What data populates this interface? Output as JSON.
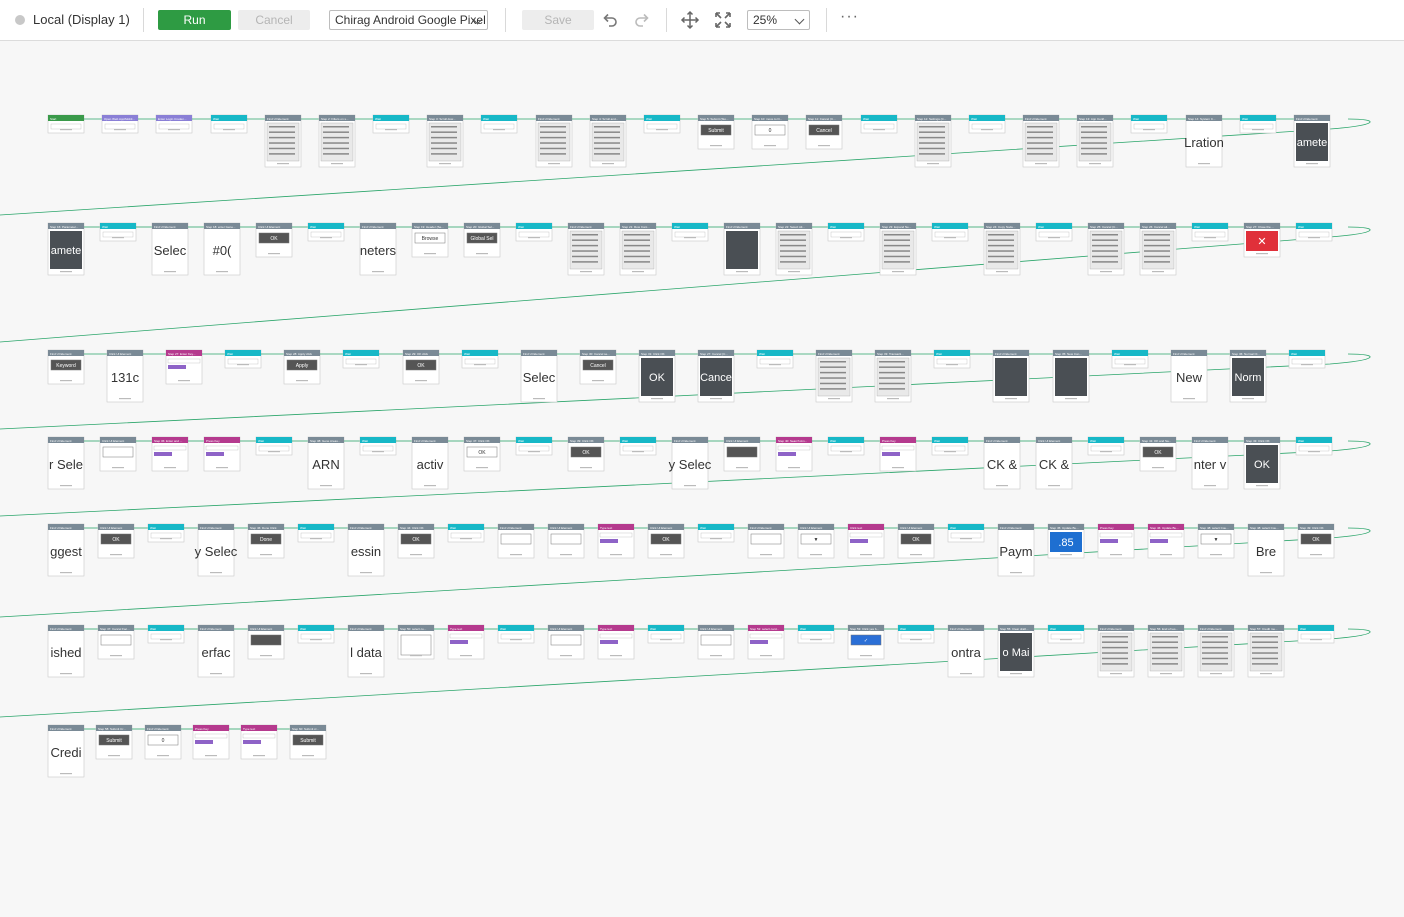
{
  "toolbar": {
    "run_target": "Local (Display 1)",
    "run_label": "Run",
    "cancel_label": "Cancel",
    "device_selected": "Chirag Android Google Pixel",
    "save_label": "Save",
    "zoom_selected": "25%",
    "more_label": "···",
    "icons": [
      "undo-icon",
      "redo-icon",
      "pan-icon",
      "fit-to-screen-icon",
      "more-icon"
    ]
  },
  "colors": {
    "run": "#2e9b43",
    "wait_node": "#17b8c7",
    "step_node": "#7a8a96",
    "type_node": "#b53a8e",
    "start_node": "#3a9a4a",
    "connector": "#2aa56a",
    "dark_screen": "#4a4f54"
  },
  "canvas": {
    "rows": [
      {
        "nodes": [
          {
            "label": "Start",
            "kind": "start"
          },
          {
            "label": "Open Web App/Mobil...",
            "kind": "purple"
          },
          {
            "label": "Enter Login Creden...",
            "kind": "purple"
          },
          {
            "label": "Wait",
            "kind": "wait"
          },
          {
            "label": "Find UI Element",
            "kind": "shot",
            "text": ""
          },
          {
            "label": "Step 2: Filters on s...",
            "kind": "shot",
            "text": ""
          },
          {
            "label": "Wait",
            "kind": "wait"
          },
          {
            "label": "Step 3: Scroll dow...",
            "kind": "shot",
            "text": ""
          },
          {
            "label": "Wait",
            "kind": "wait"
          },
          {
            "label": "Find UI Element",
            "kind": "shot",
            "text": ""
          },
          {
            "label": "Step 4: Scroll and...",
            "kind": "shot",
            "text": ""
          },
          {
            "label": "Wait",
            "kind": "wait"
          },
          {
            "label": "Step 5: Submit (Sto...",
            "kind": "button",
            "text": "Submit"
          },
          {
            "label": "Step 10: move to D...",
            "kind": "field",
            "text": "0"
          },
          {
            "label": "Step 11: Cancel (C...",
            "kind": "button",
            "text": "Cancel"
          },
          {
            "label": "Wait",
            "kind": "wait"
          },
          {
            "label": "Step 12: Settings (C...",
            "kind": "shot",
            "text": ""
          },
          {
            "label": "Wait",
            "kind": "wait"
          },
          {
            "label": "Find UI Element",
            "kind": "shot",
            "text": ""
          },
          {
            "label": "Step 13: App Confi...",
            "kind": "shot",
            "text": ""
          },
          {
            "label": "Wait",
            "kind": "wait"
          },
          {
            "label": "Step 14: System C...",
            "kind": "text",
            "text": "Lration"
          },
          {
            "label": "Wait",
            "kind": "wait"
          },
          {
            "label": "Find UI Element",
            "kind": "dark",
            "text": "amete"
          }
        ]
      },
      {
        "nodes": [
          {
            "label": "Step 16: Parameter...",
            "kind": "dark",
            "text": "amete"
          },
          {
            "label": "Wait",
            "kind": "wait"
          },
          {
            "label": "Find UI Element",
            "kind": "text",
            "text": "Selec"
          },
          {
            "label": "Step 18: enter Gene...",
            "kind": "text",
            "text": "#0("
          },
          {
            "label": "Click UI Element",
            "kind": "button",
            "text": "OK"
          },
          {
            "label": "Wait",
            "kind": "wait"
          },
          {
            "label": "Find UI Element",
            "kind": "text",
            "text": "neters"
          },
          {
            "label": "Step 19: Header (Se...",
            "kind": "field",
            "text": "Browse"
          },
          {
            "label": "Step 20: Global Sel...",
            "kind": "button",
            "text": "Global Sel"
          },
          {
            "label": "Wait",
            "kind": "wait"
          },
          {
            "label": "Find UI Element",
            "kind": "shot",
            "text": ""
          },
          {
            "label": "Step 21: Row Cont...",
            "kind": "shot",
            "text": ""
          },
          {
            "label": "Wait",
            "kind": "wait"
          },
          {
            "label": "Find UI Element",
            "kind": "dark",
            "text": ""
          },
          {
            "label": "Step 22: Select Ali...",
            "kind": "shot",
            "text": ""
          },
          {
            "label": "Wait",
            "kind": "wait"
          },
          {
            "label": "Step 23: Expand Ne...",
            "kind": "shot",
            "text": ""
          },
          {
            "label": "Wait",
            "kind": "wait"
          },
          {
            "label": "Step 24: Copy Node...",
            "kind": "shot",
            "text": ""
          },
          {
            "label": "Wait",
            "kind": "wait"
          },
          {
            "label": "Step 25: Cancel (C...",
            "kind": "shot",
            "text": ""
          },
          {
            "label": "Step 26: Cancel ali...",
            "kind": "shot",
            "text": ""
          },
          {
            "label": "Wait",
            "kind": "wait"
          },
          {
            "label": "Step 27: Close the ...",
            "kind": "red",
            "text": "✕"
          },
          {
            "label": "Wait",
            "kind": "wait"
          }
        ]
      },
      {
        "nodes": [
          {
            "label": "Find UI Element",
            "kind": "button",
            "text": "Keyword"
          },
          {
            "label": "Click UI Element",
            "kind": "text",
            "text": "131c"
          },
          {
            "label": "Step 27: Enter Key...",
            "kind": "type",
            "text": ""
          },
          {
            "label": "Wait",
            "kind": "wait"
          },
          {
            "label": "Step 28: Apply click",
            "kind": "button",
            "text": "Apply"
          },
          {
            "label": "Wait",
            "kind": "wait"
          },
          {
            "label": "Step 29: OK click",
            "kind": "button",
            "text": "OK"
          },
          {
            "label": "Wait",
            "kind": "wait"
          },
          {
            "label": "Find UI Element",
            "kind": "text",
            "text": "Selec"
          },
          {
            "label": "Step 30: Cancel se...",
            "kind": "button",
            "text": "Cancel"
          },
          {
            "label": "Step 31: Click OK",
            "kind": "dark",
            "text": "OK"
          },
          {
            "label": "Step 27: Cancel (C...",
            "kind": "dark",
            "text": "Cance"
          },
          {
            "label": "Wait",
            "kind": "wait"
          },
          {
            "label": "Find UI Element",
            "kind": "shot",
            "text": ""
          },
          {
            "label": "Step 33: Transacti...",
            "kind": "shot",
            "text": ""
          },
          {
            "label": "Wait",
            "kind": "wait"
          },
          {
            "label": "Find UI Element",
            "kind": "dark",
            "text": ""
          },
          {
            "label": "Step 35: New Con...",
            "kind": "dark",
            "text": ""
          },
          {
            "label": "Wait",
            "kind": "wait"
          },
          {
            "label": "Find UI Element",
            "kind": "text",
            "text": "New"
          },
          {
            "label": "Step 36: Normal Cl...",
            "kind": "dark",
            "text": "Norm"
          },
          {
            "label": "Wait",
            "kind": "wait"
          }
        ]
      },
      {
        "nodes": [
          {
            "label": "Find UI Element",
            "kind": "text",
            "text": "r Sele"
          },
          {
            "label": "Click UI Element",
            "kind": "field",
            "text": ""
          },
          {
            "label": "Step 36: Enter and ...",
            "kind": "type",
            "text": ""
          },
          {
            "label": "Press Key",
            "kind": "type",
            "text": ""
          },
          {
            "label": "Wait",
            "kind": "wait"
          },
          {
            "label": "Step 38: Gene Areas...",
            "kind": "text",
            "text": "ARN"
          },
          {
            "label": "Wait",
            "kind": "wait"
          },
          {
            "label": "Find UI Element",
            "kind": "text",
            "text": "activ"
          },
          {
            "label": "Step 47: Click OK",
            "kind": "field",
            "text": "OK"
          },
          {
            "label": "Wait",
            "kind": "wait"
          },
          {
            "label": "Step 39: Click OK",
            "kind": "button",
            "text": "OK"
          },
          {
            "label": "Wait",
            "kind": "wait"
          },
          {
            "label": "Find UI Element",
            "kind": "text",
            "text": "y Selec"
          },
          {
            "label": "Click UI Element",
            "kind": "button",
            "text": ""
          },
          {
            "label": "Step 40: Search Am...",
            "kind": "type",
            "text": ""
          },
          {
            "label": "Wait",
            "kind": "wait"
          },
          {
            "label": "Press Key",
            "kind": "type",
            "text": ""
          },
          {
            "label": "Wait",
            "kind": "wait"
          },
          {
            "label": "Find UI Element",
            "kind": "text",
            "text": "CK &"
          },
          {
            "label": "Click UI Element",
            "kind": "text",
            "text": "CK &"
          },
          {
            "label": "Wait",
            "kind": "wait"
          },
          {
            "label": "Step 41: OK and Sa...",
            "kind": "button",
            "text": "OK"
          },
          {
            "label": "Find UI Element",
            "kind": "text",
            "text": "nter v"
          },
          {
            "label": "Step 43: Click OK",
            "kind": "dark",
            "text": "OK"
          },
          {
            "label": "Wait",
            "kind": "wait"
          }
        ]
      },
      {
        "nodes": [
          {
            "label": "Find UI Element",
            "kind": "text",
            "text": "ggest"
          },
          {
            "label": "Click UI Element",
            "kind": "button",
            "text": "OK"
          },
          {
            "label": "Wait",
            "kind": "wait"
          },
          {
            "label": "Find UI Element",
            "kind": "text",
            "text": "y Selec"
          },
          {
            "label": "Step 46: Done Click",
            "kind": "button",
            "text": "Done"
          },
          {
            "label": "Wait",
            "kind": "wait"
          },
          {
            "label": "Find UI Element",
            "kind": "text",
            "text": "essin"
          },
          {
            "label": "Step 44: Click OK",
            "kind": "button",
            "text": "OK"
          },
          {
            "label": "Wait",
            "kind": "wait"
          },
          {
            "label": "Find UI Element",
            "kind": "field",
            "text": ""
          },
          {
            "label": "Click UI Element",
            "kind": "field",
            "text": ""
          },
          {
            "label": "Type text",
            "kind": "type",
            "text": ""
          },
          {
            "label": "Click UI Element",
            "kind": "button",
            "text": "OK"
          },
          {
            "label": "Wait",
            "kind": "wait"
          },
          {
            "label": "Find UI Element",
            "kind": "field",
            "text": ""
          },
          {
            "label": "Click UI Element",
            "kind": "arrow",
            "text": "▼"
          },
          {
            "label": "Click text",
            "kind": "type",
            "text": ""
          },
          {
            "label": "Click UI Element",
            "kind": "button",
            "text": "OK"
          },
          {
            "label": "Wait",
            "kind": "wait"
          },
          {
            "label": "Find UI Element",
            "kind": "text",
            "text": "Paym"
          },
          {
            "label": "Step 45: Update Bu...",
            "kind": "blue",
            "text": ".85"
          },
          {
            "label": "Press Key",
            "kind": "type",
            "text": ""
          },
          {
            "label": "Step 46: Update Bu...",
            "kind": "type",
            "text": ""
          },
          {
            "label": "Step 48: select Cou...",
            "kind": "arrow",
            "text": "▼"
          },
          {
            "label": "Step 48: select Cou...",
            "kind": "text",
            "text": "Bre"
          },
          {
            "label": "Step 49: Click OK",
            "kind": "button",
            "text": "OK"
          }
        ]
      },
      {
        "nodes": [
          {
            "label": "Find UI Element",
            "kind": "text",
            "text": "ished"
          },
          {
            "label": "Step 47: Cancel Fac...",
            "kind": "field",
            "text": ""
          },
          {
            "label": "Wait",
            "kind": "wait"
          },
          {
            "label": "Find UI Element",
            "kind": "text",
            "text": "erfac"
          },
          {
            "label": "Click UI Element",
            "kind": "button",
            "text": ""
          },
          {
            "label": "Wait",
            "kind": "wait"
          },
          {
            "label": "Find UI Element",
            "kind": "text",
            "text": "l data"
          },
          {
            "label": "Step 50: select co...",
            "kind": "frame",
            "text": ""
          },
          {
            "label": "Type text",
            "kind": "type",
            "text": ""
          },
          {
            "label": "Wait",
            "kind": "wait"
          },
          {
            "label": "Click UI Element",
            "kind": "field",
            "text": ""
          },
          {
            "label": "Type text",
            "kind": "type",
            "text": ""
          },
          {
            "label": "Wait",
            "kind": "wait"
          },
          {
            "label": "Click UI Element",
            "kind": "field",
            "text": ""
          },
          {
            "label": "Step 52: select card...",
            "kind": "type",
            "text": ""
          },
          {
            "label": "Wait",
            "kind": "wait"
          },
          {
            "label": "Step 53: Click yes b...",
            "kind": "check",
            "text": "✓"
          },
          {
            "label": "Wait",
            "kind": "wait"
          },
          {
            "label": "Find UI Element",
            "kind": "text",
            "text": "ontra"
          },
          {
            "label": "Step 55: Clear draft...",
            "kind": "dark",
            "text": "o Mai"
          },
          {
            "label": "Wait",
            "kind": "wait"
          },
          {
            "label": "Find UI Element",
            "kind": "shot",
            "text": ""
          },
          {
            "label": "Step 56: End of tes...",
            "kind": "shot",
            "text": ""
          },
          {
            "label": "Find UI Element",
            "kind": "shot",
            "text": ""
          },
          {
            "label": "Step 57: Credit me...",
            "kind": "shot",
            "text": ""
          },
          {
            "label": "Wait",
            "kind": "wait"
          }
        ]
      },
      {
        "nodes": [
          {
            "label": "Find UI Element",
            "kind": "text",
            "text": "Credi"
          },
          {
            "label": "Step 58: Submit Cr...",
            "kind": "button",
            "text": "Submit"
          },
          {
            "label": "Find UI Element",
            "kind": "field",
            "text": "0"
          },
          {
            "label": "Press Key",
            "kind": "type",
            "text": ""
          },
          {
            "label": "Type text",
            "kind": "type",
            "text": ""
          },
          {
            "label": "Step 60: Submit cr...",
            "kind": "button",
            "text": "Submit"
          }
        ]
      }
    ]
  }
}
